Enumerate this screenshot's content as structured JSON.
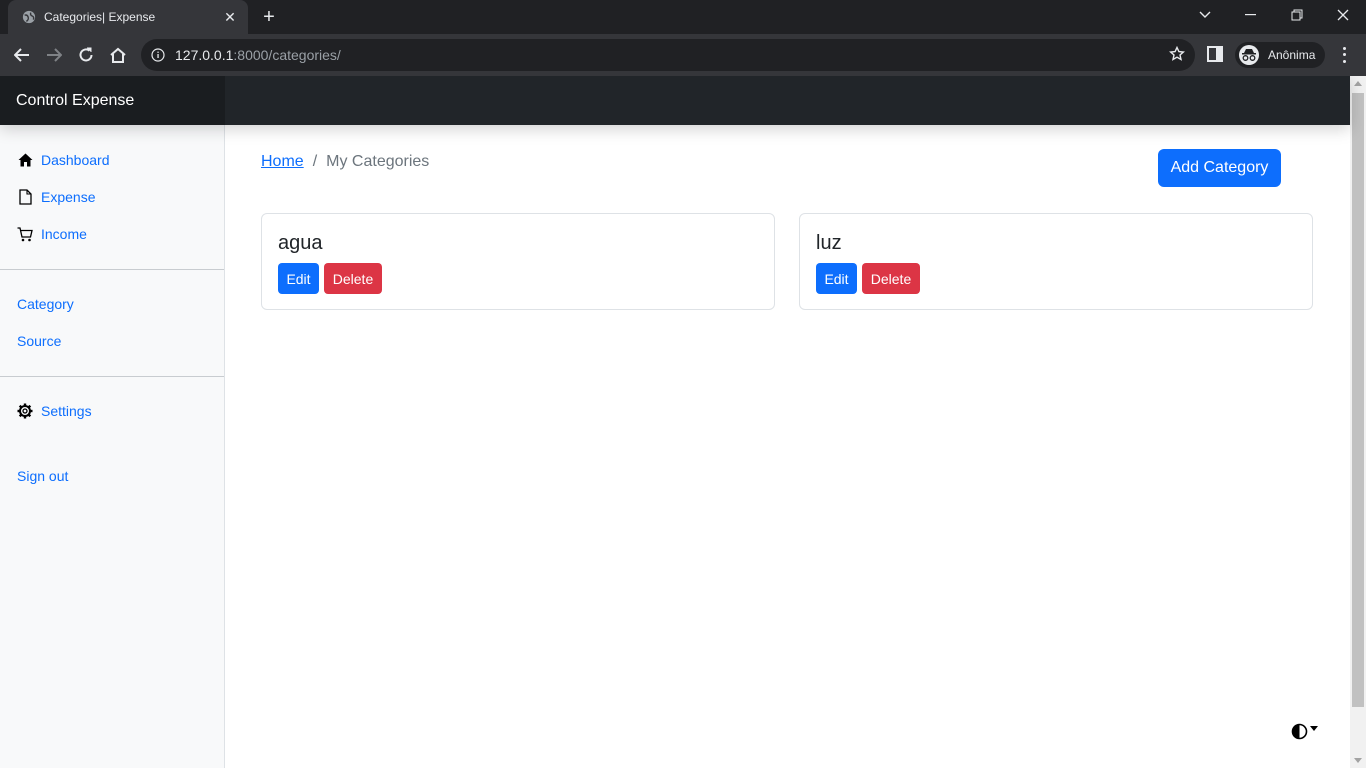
{
  "browser": {
    "tab_title": "Categories| Expense",
    "url_host": "127.0.0.1",
    "url_rest": ":8000/categories/",
    "profile_name": "Anônima"
  },
  "app": {
    "brand": "Control Expense"
  },
  "sidebar": {
    "items": [
      {
        "label": "Dashboard",
        "icon": "house-icon"
      },
      {
        "label": "Expense",
        "icon": "file-icon"
      },
      {
        "label": "Income",
        "icon": "cart-icon"
      },
      {
        "label": "Category"
      },
      {
        "label": "Source"
      },
      {
        "label": "Settings",
        "icon": "gear-icon"
      },
      {
        "label": "Sign out"
      }
    ]
  },
  "breadcrumb": {
    "home": "Home",
    "separator": "/",
    "current": "My Categories"
  },
  "actions": {
    "add_category": "Add Category"
  },
  "categories": [
    {
      "name": "agua",
      "edit": "Edit",
      "delete": "Delete"
    },
    {
      "name": "luz",
      "edit": "Edit",
      "delete": "Delete"
    }
  ],
  "colors": {
    "primary": "#0d6efd",
    "danger": "#dc3545",
    "header": "#212529",
    "sidebar_bg": "#f8f9fa"
  }
}
